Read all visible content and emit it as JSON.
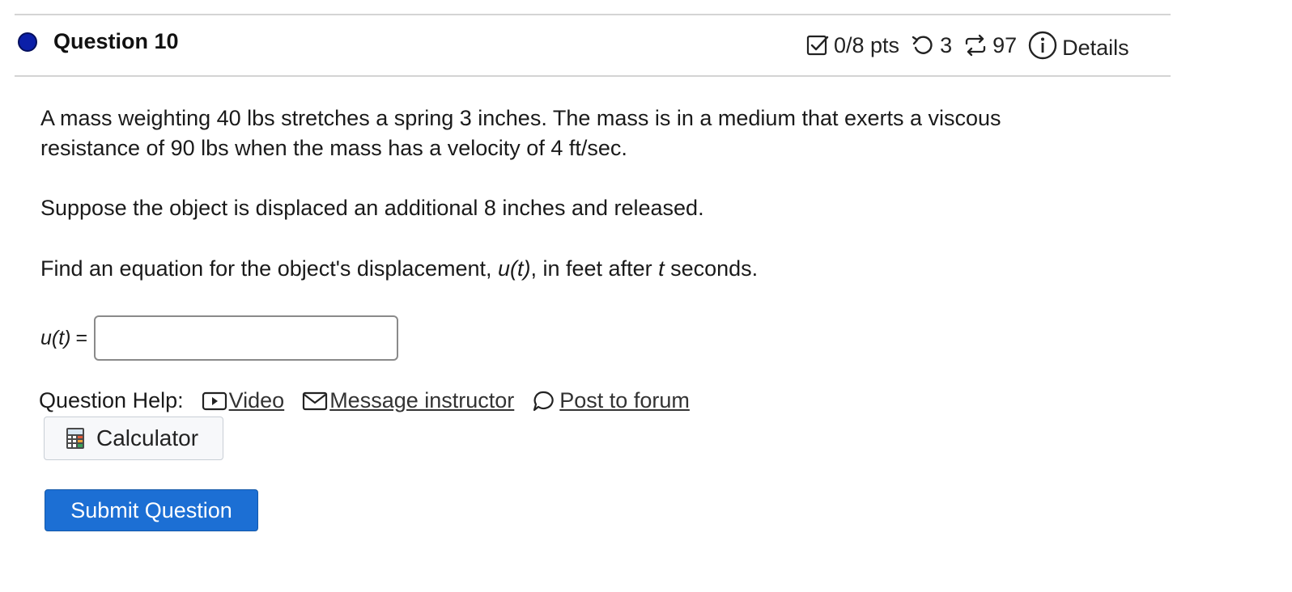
{
  "question": {
    "title": "Question 10",
    "status_color": "#0b1fa8"
  },
  "meta": {
    "points": "0/8 pts",
    "attempts": "3",
    "versions": "97",
    "details_label": "Details"
  },
  "problem": {
    "paragraph1": "A mass weighting 40 lbs stretches a spring 3 inches. The mass is in a medium that exerts a viscous resistance of 90 lbs when the mass has a velocity of 4 ft/sec.",
    "paragraph2": "Suppose the object is displaced an additional 8 inches and released.",
    "paragraph3_pre": "Find an equation for the object's displacement, ",
    "paragraph3_func": "u(t)",
    "paragraph3_mid": ", in feet after ",
    "paragraph3_var": "t",
    "paragraph3_post": " seconds."
  },
  "answer": {
    "label": "u(t)",
    "equals": "=",
    "value": ""
  },
  "help": {
    "label": "Question Help:",
    "video": "Video",
    "message": "Message instructor",
    "forum": "Post to forum"
  },
  "calculator": {
    "label": "Calculator"
  },
  "submit": {
    "label": "Submit Question",
    "color": "#1c6fd4"
  }
}
